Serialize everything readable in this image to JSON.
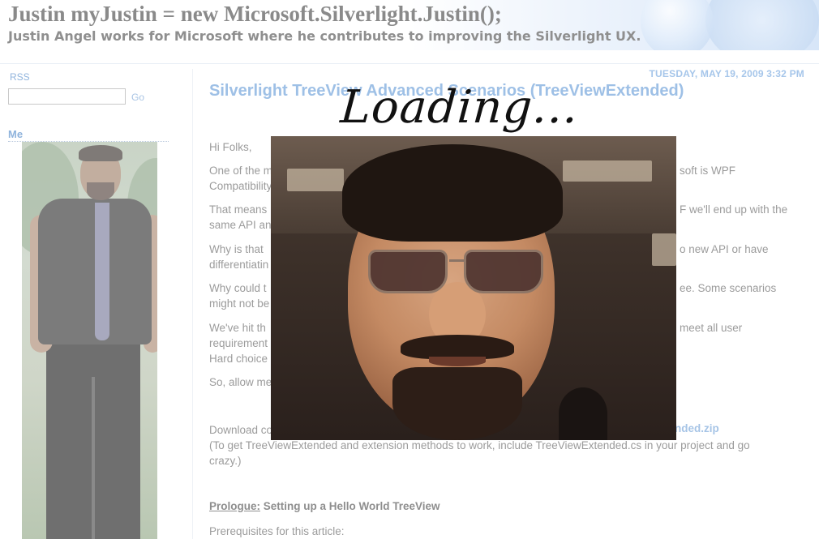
{
  "header": {
    "blog_title": "Justin myJustin = new Microsoft.Silverlight.Justin();",
    "tagline": "Justin Angel works for Microsoft where he contributes to improving the Silverlight UX."
  },
  "sidebar": {
    "rss_label": "RSS",
    "search_placeholder": "",
    "go_label": "Go",
    "me_heading": "Me"
  },
  "post": {
    "date": "TUESDAY, MAY 19, 2009 3:32 PM",
    "title": "Silverlight TreeView Advanced Scenarios (TreeViewExtended)",
    "greeting": "Hi Folks,",
    "para1_left": "One of the m",
    "para1_right": "soft is WPF",
    "para1_line2": "Compatibility",
    "para2_left": "That means",
    "para2_right": "F we'll end up with the",
    "para2_line2": "same API an",
    "para3_left": "Why is that",
    "para3_right": "o new API or have",
    "para3_line2": "differentiatin",
    "para4_left": "Why could t",
    "para4_right": "ee. Some scenarios",
    "para4_line2": "might not be",
    "para5_left": "We've hit th",
    "para5_right": "meet all user",
    "para5_line2": "requirement",
    "para5_line3": "Hard choice",
    "para6_left": "So, allow me",
    "download_left": "Download co",
    "download_link_right": "nded.zip",
    "download_note_1": "(To get TreeViewExtended and extension methods to work, include TreeViewExtended.cs in your project and go",
    "download_note_2": "crazy.)",
    "prologue_label": "Prologue:",
    "prologue_text": " Setting up a Hello World TreeView",
    "prereq": "Prerequisites for this article:"
  },
  "overlay": {
    "loading_text": "Loading..."
  }
}
